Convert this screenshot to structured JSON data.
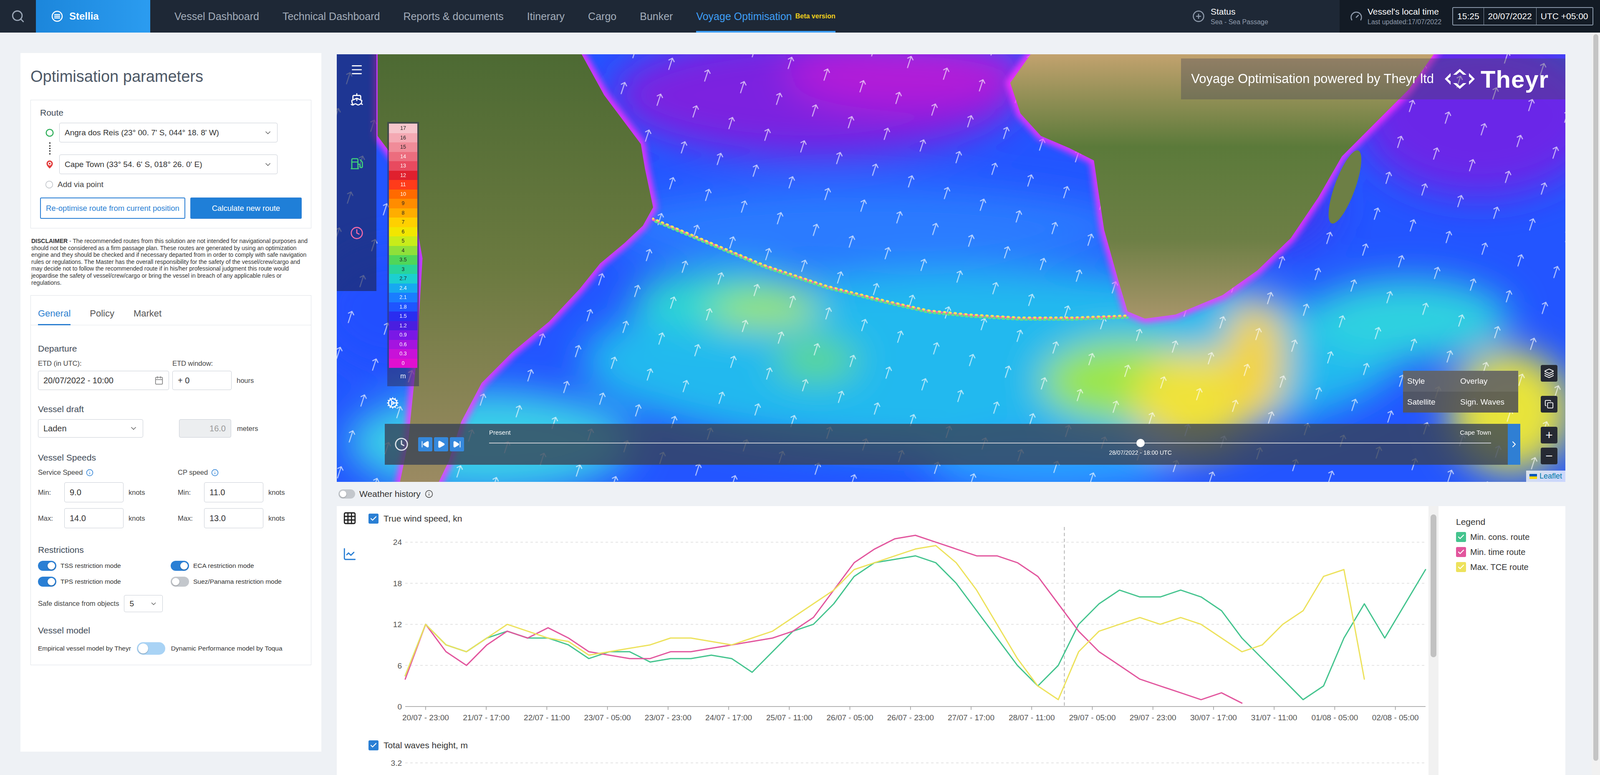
{
  "nav": {
    "brand": "Stellia",
    "items": [
      {
        "label": "Vessel Dashboard",
        "selected": false
      },
      {
        "label": "Technical Dashboard",
        "selected": false
      },
      {
        "label": "Reports & documents",
        "selected": false
      },
      {
        "label": "Itinerary",
        "selected": false
      },
      {
        "label": "Cargo",
        "selected": false
      },
      {
        "label": "Bunker",
        "selected": false
      },
      {
        "label": "Voyage Optimisation",
        "selected": true,
        "badge": "Beta version"
      }
    ],
    "status": {
      "label": "Status",
      "value": "Sea - Sea Passage"
    },
    "local_time": {
      "label": "Vessel's local time",
      "updated": "Last updated:17/07/2022",
      "time": "15:25",
      "date": "20/07/2022",
      "utc": "UTC +05:00"
    }
  },
  "params": {
    "title": "Optimisation parameters",
    "route": {
      "label": "Route",
      "origin": "Angra dos Reis (23° 00. 7' S, 044° 18. 8' W)",
      "destination": "Cape Town (33° 54. 6' S, 018° 26. 0' E)",
      "add_via": "Add via point",
      "buttons": [
        {
          "label": "Re-optimise route from current position",
          "primary": false
        },
        {
          "label": "Calculate new route",
          "primary": true
        }
      ]
    },
    "disclaimer": {
      "title": "DISCLAIMER",
      "text": "- The recommended routes from this solution are not intended for navigational purposes and should not be considered as a firm passage plan. These routes are generated by using an optimization engine and they should be checked and if necessary departed from in order to comply with safe navigation rules or regulations. The Master has the overall responsibility for the safety of the vessel/crew/cargo and may decide not to follow the recommended route if in his/her professional judgment this route would jeopardise the safety of vessel/crew/cargo or bring the vessel in breach of any applicable rules or regulations."
    },
    "tabs": [
      {
        "label": "General",
        "selected": true
      },
      {
        "label": "Policy",
        "selected": false
      },
      {
        "label": "Market",
        "selected": false
      }
    ],
    "departure": {
      "label": "Departure",
      "etd_label": "ETD (in UTC):",
      "etd": "20/07/2022 - 10:00",
      "window_label": "ETD window:",
      "window": "+ 0",
      "window_unit": "hours"
    },
    "draft": {
      "label": "Vessel draft",
      "value": "Laden",
      "meters": "16.0",
      "meters_disabled": true,
      "unit": "meters"
    },
    "speeds": {
      "label": "Vessel Speeds",
      "groups": [
        {
          "label": "Service Speed",
          "rows": [
            {
              "label": "Min:",
              "value": "9.0",
              "unit": "knots"
            },
            {
              "label": "Max:",
              "value": "14.0",
              "unit": "knots"
            }
          ]
        },
        {
          "label": "CP speed",
          "rows": [
            {
              "label": "Min:",
              "value": "11.0",
              "unit": "knots"
            },
            {
              "label": "Max:",
              "value": "13.0",
              "unit": "knots"
            }
          ]
        }
      ]
    },
    "restrictions": {
      "label": "Restrictions",
      "items": [
        {
          "label": "TSS restriction mode",
          "on": true
        },
        {
          "label": "ECA restriction mode",
          "on": true
        },
        {
          "label": "TPS restriction mode",
          "on": true
        },
        {
          "label": "Suez/Panama restriction mode",
          "on": false
        }
      ],
      "safe_distance_label": "Safe distance from objects",
      "safe_distance": "5"
    },
    "model": {
      "label": "Vessel model",
      "left": "Empirical vessel model by Theyr",
      "right": "Dynamic Performance model by Toqua",
      "right_selected": false
    }
  },
  "map": {
    "header": "Voyage Optimisation powered by Theyr ltd",
    "logo": "Theyr",
    "scale": {
      "unit": "m",
      "steps": [
        {
          "label": "17",
          "color": "#f6c6cc"
        },
        {
          "label": "16",
          "color": "#f4a9b3"
        },
        {
          "label": "15",
          "color": "#f08c99"
        },
        {
          "label": "14",
          "color": "#ec6d7e"
        },
        {
          "label": "13",
          "color": "#e84a5f"
        },
        {
          "label": "12",
          "color": "#e0202e"
        },
        {
          "label": "11",
          "color": "#ff3b1a"
        },
        {
          "label": "10",
          "color": "#ff6a00"
        },
        {
          "label": "9",
          "color": "#ff8c00"
        },
        {
          "label": "8",
          "color": "#ffad00"
        },
        {
          "label": "7",
          "color": "#ffd000"
        },
        {
          "label": "6",
          "color": "#f2e600"
        },
        {
          "label": "5",
          "color": "#c8ec1a"
        },
        {
          "label": "4",
          "color": "#8fe03a"
        },
        {
          "label": "3.5",
          "color": "#4fd65a"
        },
        {
          "label": "3",
          "color": "#28d49a"
        },
        {
          "label": "2.7",
          "color": "#1ccfd0"
        },
        {
          "label": "2.4",
          "color": "#17a9f0"
        },
        {
          "label": "2.1",
          "color": "#1a7dff"
        },
        {
          "label": "1.8",
          "color": "#1f55ff"
        },
        {
          "label": "1.5",
          "color": "#2a2df0"
        },
        {
          "label": "1.2",
          "color": "#4a1ee0"
        },
        {
          "label": "0.9",
          "color": "#7a18e6"
        },
        {
          "label": "0.6",
          "color": "#a414e0"
        },
        {
          "label": "0.3",
          "color": "#c812d8"
        },
        {
          "label": "0",
          "color": "#e010d0"
        }
      ]
    },
    "style_panel": [
      {
        "label": "Style",
        "value": "Overlay"
      },
      {
        "label": "Satellite",
        "value": "Sign. Waves"
      }
    ],
    "zoom": [
      "+",
      "−"
    ],
    "timeline": {
      "start": "Present",
      "end": "Cape Town",
      "current": "28/07/2022 - 18:00 UTC",
      "level": 0.65
    },
    "attribution": "Leaflet"
  },
  "weather_history": {
    "label": "Weather history",
    "on": false
  },
  "legend_title": "Legend",
  "charts": [
    {
      "title": "True wind speed, kn",
      "checked": true,
      "y_ticks": [
        "0",
        "6",
        "12",
        "18",
        "24"
      ],
      "x_ticks": [
        "20/07 - 23:00",
        "21/07 - 17:00",
        "22/07 - 11:00",
        "23/07 - 05:00",
        "23/07 - 23:00",
        "24/07 - 17:00",
        "25/07 - 11:00",
        "26/07 - 05:00",
        "26/07 - 23:00",
        "27/07 - 17:00",
        "28/07 - 11:00",
        "29/07 - 05:00",
        "29/07 - 23:00",
        "30/07 - 17:00",
        "31/07 - 11:00",
        "01/08 - 05:00",
        "02/08 - 05:00"
      ],
      "cursor": 32.3,
      "series": [
        {
          "label": "Min. cons. route",
          "color": "#44c48e",
          "checked": true,
          "values": [
            4.5,
            12,
            9,
            8,
            10,
            11,
            10,
            10,
            9,
            7,
            8,
            8,
            6.5,
            7,
            7,
            7.5,
            7,
            5,
            8,
            11,
            12,
            15,
            19,
            21,
            21.5,
            22,
            21,
            18,
            14,
            10,
            6,
            3,
            6,
            12,
            15,
            17,
            16,
            16,
            17,
            16,
            14,
            10,
            7,
            4,
            1,
            3,
            10,
            15,
            10,
            15,
            20
          ]
        },
        {
          "label": "Min. time route",
          "color": "#e2559d",
          "checked": true,
          "values": [
            4,
            12,
            8,
            6,
            9,
            11,
            10,
            11.5,
            10,
            8,
            7.5,
            7,
            7,
            8,
            8,
            8.5,
            9,
            9.5,
            10,
            11,
            13,
            17,
            21,
            23,
            24.5,
            25,
            24,
            23,
            22,
            22,
            21,
            19,
            15,
            11,
            8,
            6,
            4,
            3,
            2,
            1,
            2,
            0.5
          ]
        },
        {
          "label": "Max. TCE route",
          "color": "#ede25c",
          "checked": true,
          "values": [
            4.5,
            12,
            9,
            8,
            10,
            12,
            11,
            10,
            9.5,
            7.5,
            8,
            8.5,
            9,
            10,
            10,
            9.5,
            9,
            10,
            11,
            13,
            15,
            17,
            20,
            21,
            22,
            23,
            23.5,
            21,
            17,
            12,
            7,
            3,
            1,
            8,
            11,
            12,
            13,
            12,
            13,
            12,
            10,
            8,
            9,
            12,
            14,
            19,
            20,
            4
          ]
        }
      ]
    },
    {
      "title": "Total waves height, m",
      "checked": true,
      "y_ticks": [
        "3.2"
      ],
      "series": []
    }
  ]
}
